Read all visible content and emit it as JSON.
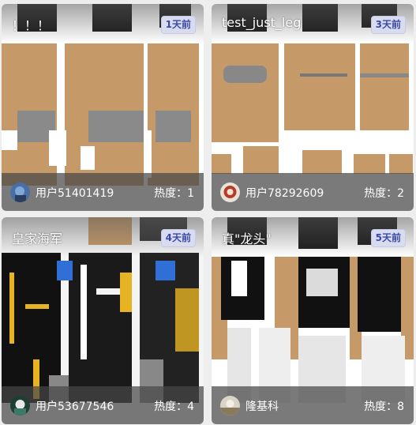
{
  "cards": [
    {
      "title": "！！！",
      "time": "1天前",
      "user": "用户51401419",
      "heat_label": "热度：",
      "heat": "1",
      "avatar_icon": "avatar-icon"
    },
    {
      "title": "test_just_leg",
      "time": "3天前",
      "user": "用户78292609",
      "heat_label": "热度：",
      "heat": "2",
      "avatar_icon": "avatar-icon"
    },
    {
      "title": "皇家海军",
      "time": "4天前",
      "user": "用户53677546",
      "heat_label": "热度：",
      "heat": "4",
      "avatar_icon": "avatar-icon"
    },
    {
      "title": "真\"龙头\"",
      "time": "5天前",
      "user": "隆基科",
      "heat_label": "热度：",
      "heat": "8",
      "avatar_icon": "avatar-icon"
    }
  ],
  "colors": {
    "badge_text": "#3949ab",
    "badge_bg": "#d9dcef",
    "skin_tone": "#c69a68"
  }
}
